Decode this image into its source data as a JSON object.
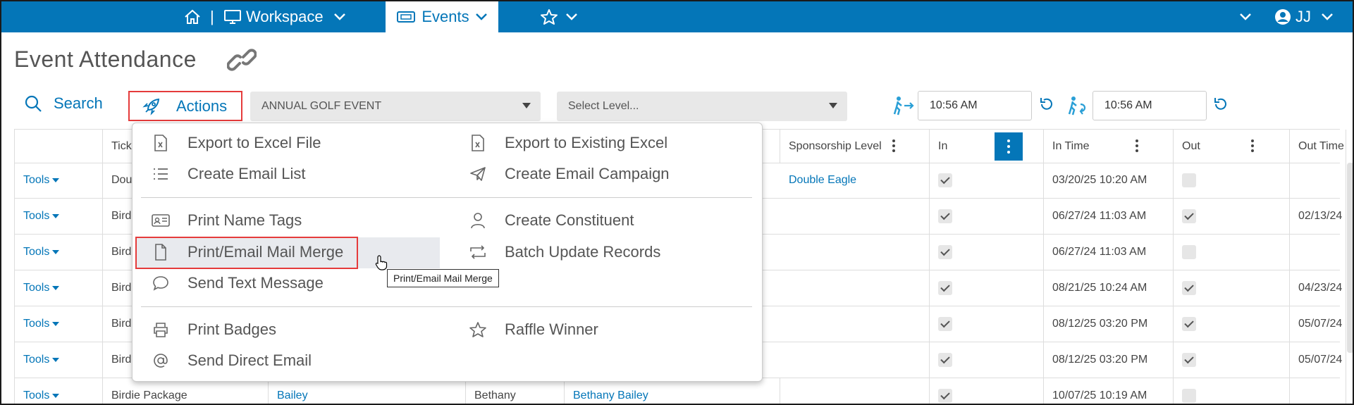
{
  "nav": {
    "workspace_label": "Workspace",
    "separator": "|",
    "events_label": "Events",
    "user_initials": "JJ"
  },
  "page": {
    "title": "Event Attendance"
  },
  "toolbar": {
    "search_label": "Search",
    "actions_label": "Actions",
    "event_select": "ANNUAL GOLF EVENT",
    "level_select": "Select Level...",
    "time_in": "10:56 AM",
    "time_out": "10:56 AM"
  },
  "table": {
    "headers": [
      "",
      "Tick",
      "",
      "",
      "",
      "Sponsorship Level",
      "In",
      "In Time",
      "Out",
      "Out Time"
    ],
    "rows": [
      {
        "tools": "Tools",
        "ticket": "Dou",
        "sponsor": "Double Eagle",
        "in": true,
        "in_time": "03/20/25 10:20 AM",
        "out": false,
        "out_time": ""
      },
      {
        "tools": "Tools",
        "ticket": "Bird",
        "sponsor": "",
        "in": true,
        "in_time": "06/27/24 11:03 AM",
        "out": true,
        "out_time": "02/13/24"
      },
      {
        "tools": "Tools",
        "ticket": "Bird",
        "sponsor": "",
        "in": true,
        "in_time": "06/27/24 11:03 AM",
        "out": false,
        "out_time": ""
      },
      {
        "tools": "Tools",
        "ticket": "Bird",
        "sponsor": "",
        "in": true,
        "in_time": "08/21/25 10:24 AM",
        "out": true,
        "out_time": "04/23/24"
      },
      {
        "tools": "Tools",
        "ticket": "Bird",
        "sponsor": "",
        "in": true,
        "in_time": "08/12/25 03:20 PM",
        "out": true,
        "out_time": "05/07/24"
      },
      {
        "tools": "Tools",
        "ticket": "Bird",
        "sponsor": "",
        "in": true,
        "in_time": "08/12/25 03:20 PM",
        "out": true,
        "out_time": "05/07/24"
      },
      {
        "tools": "Tools",
        "ticket": "Birdie Package",
        "last": "Bailey",
        "first": "Bethany",
        "full": "Bethany Bailey",
        "sponsor": "",
        "in": true,
        "in_time": "10/07/25 10:19 AM",
        "out": false,
        "out_time": ""
      }
    ]
  },
  "menu": {
    "left": [
      "Export to Excel File",
      "Create Email List",
      "Print Name Tags",
      "Print/Email Mail Merge",
      "Send Text Message",
      "Print Badges",
      "Send Direct Email"
    ],
    "right": [
      "Export to Existing Excel",
      "Create Email Campaign",
      "Create Constituent",
      "Batch Update Records",
      "Raffle Winner"
    ]
  },
  "tooltip": "Print/Email Mail Merge",
  "colors": {
    "brand": "#0476b8",
    "highlight_border": "#e53b3b"
  }
}
